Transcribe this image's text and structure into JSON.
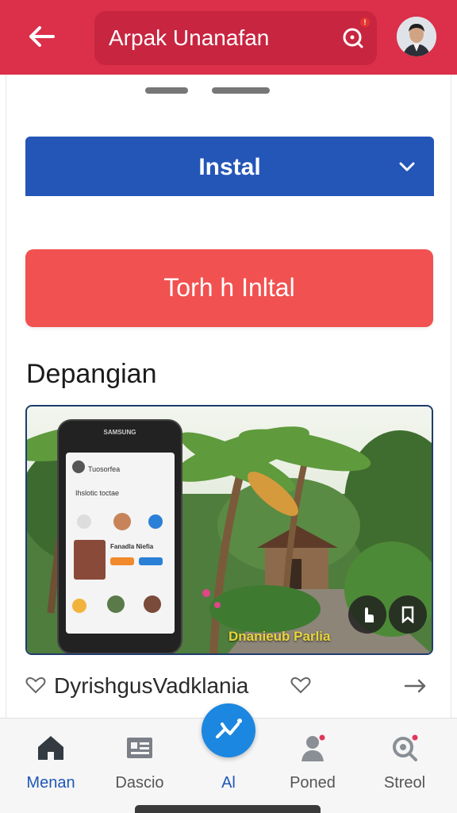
{
  "header": {
    "title": "Arpak Unanafan",
    "notification_count": "!",
    "colors": {
      "bar": "#dc2f4a",
      "pill": "#c82540"
    },
    "icons": {
      "back": "arrow-left-icon",
      "notifications": "chat-bell-icon",
      "avatar": "user-avatar"
    }
  },
  "main": {
    "install_select": {
      "label": "Instal",
      "icon": "chevron-down-icon",
      "color": "#2456b8"
    },
    "touch_button": {
      "label": "Torh h Inltal",
      "color": "#f15150"
    },
    "section_heading": "Depangian",
    "photo": {
      "caption": "Dnanieub Parlia",
      "phone_mockup": {
        "brand": "SAMSUNG",
        "row_title": "Tuosorfea",
        "row_subtitle": "Ihslotic toctae",
        "card_name": "Fanadla Niefia"
      },
      "media_buttons": [
        "hand-pointer-icon",
        "bookmark-icon"
      ]
    },
    "row": {
      "label": "DyrishgusVadklania",
      "icons": [
        "heart-outline-icon",
        "heart-outline-icon",
        "arrow-right-icon"
      ]
    }
  },
  "bottom_nav": {
    "items": [
      {
        "label": "Menan",
        "icon": "home-icon",
        "active": true
      },
      {
        "label": "Dascio",
        "icon": "id-card-icon",
        "active": false
      },
      {
        "label": "Al",
        "icon": "ai-sparkle-icon",
        "active": false
      },
      {
        "label": "Poned",
        "icon": "person-icon",
        "active": false
      },
      {
        "label": "Streol",
        "icon": "search-badge-icon",
        "active": false
      }
    ],
    "accent": "#1f57b8",
    "fab_color": "#1c87e0"
  }
}
